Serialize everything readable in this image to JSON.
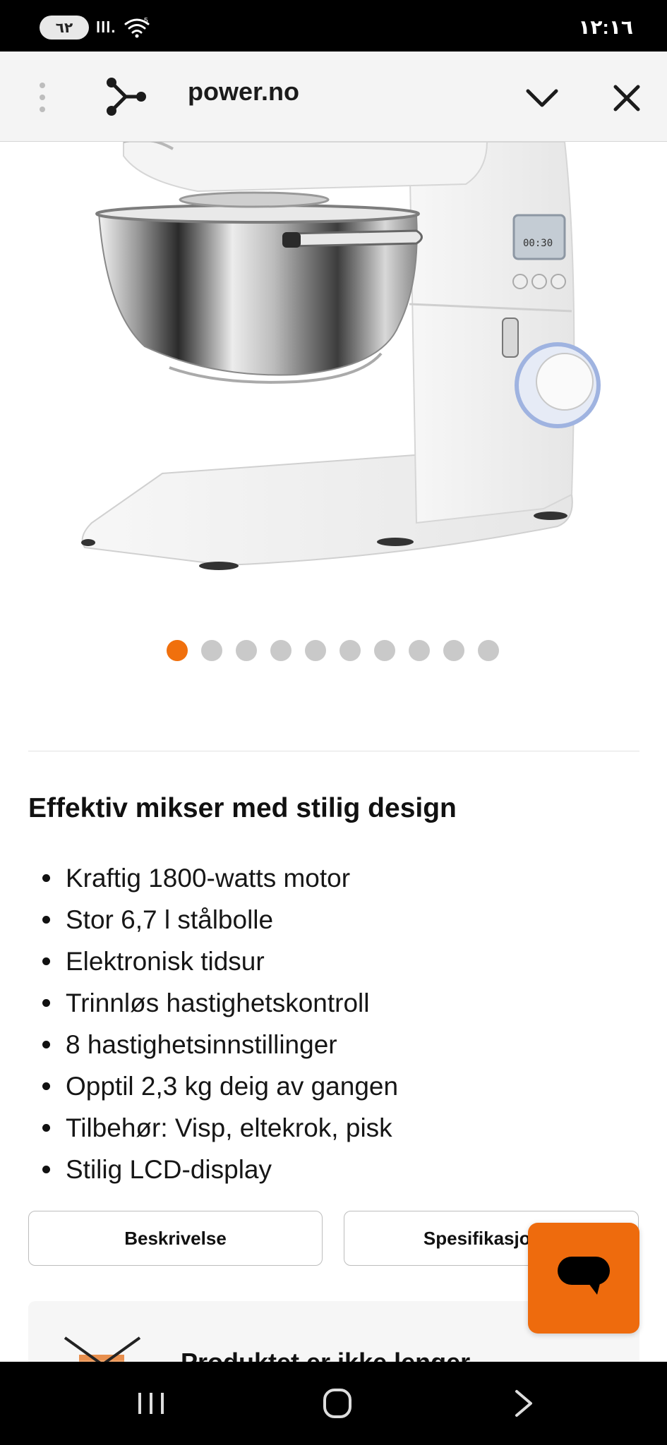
{
  "status_bar": {
    "battery_level": "٦٢",
    "signal": "lll.",
    "wifi_badge": "5",
    "time": "١٢:١٦"
  },
  "browser_bar": {
    "site": "power.no"
  },
  "carousel": {
    "total": 10,
    "active_index": 0,
    "active_color": "#f0700d"
  },
  "description": {
    "heading": "Effektiv mikser med stilig design",
    "features": [
      "Kraftig 1800-watts motor",
      "Stor 6,7 l stålbolle",
      "Elektronisk tidsur",
      "Trinnløs hastighetskontroll",
      "8 hastighetsinnstillinger",
      "Opptil 2,3 kg deig av gangen",
      "Tilbehør: Visp, eltekrok, pisk",
      "Stilig LCD-display"
    ]
  },
  "tabs": {
    "description_label": "Beskrivelse",
    "specifications_label": "Spesifikasjoner"
  },
  "notice": {
    "text": "Produktet er ikke lenger"
  },
  "chat": {
    "color": "#ee6b0d",
    "icon": "chat-bubble-icon"
  },
  "mixer_display": {
    "time": "00:30"
  },
  "nav_bar": {
    "icons": [
      "recents-icon",
      "home-icon",
      "back-icon"
    ]
  }
}
